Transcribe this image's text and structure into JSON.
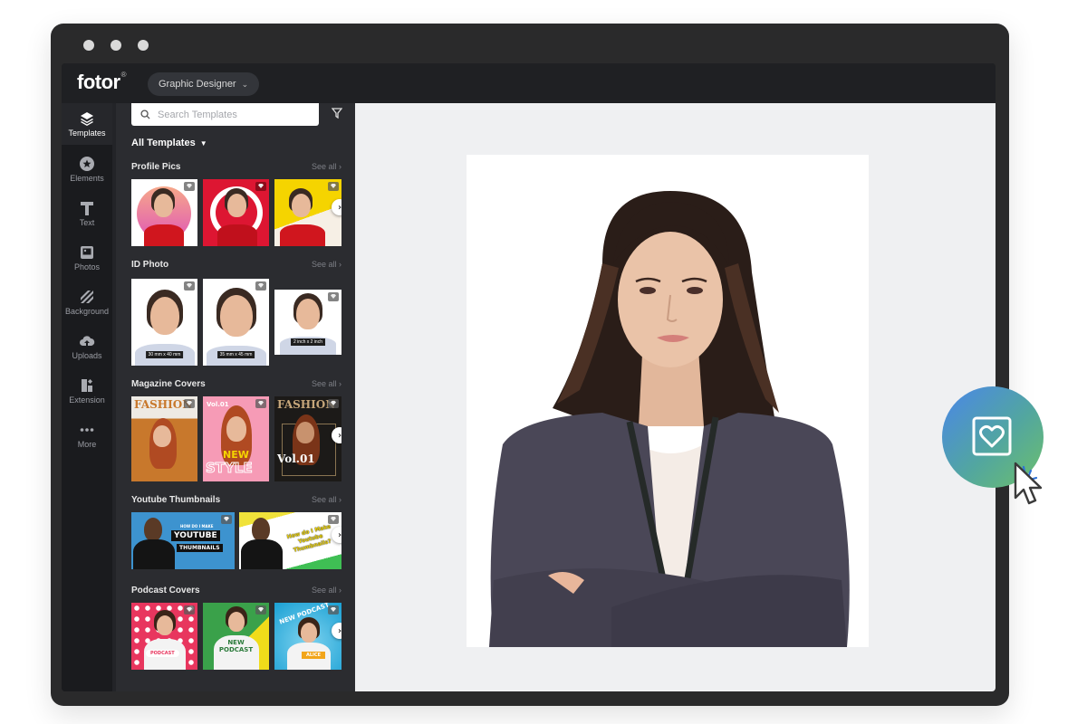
{
  "window": {
    "traffic_lights": [
      "dot",
      "dot",
      "dot"
    ]
  },
  "topbar": {
    "logo": "fotor",
    "logo_mark": "®",
    "mode_label": "Graphic Designer",
    "mode_icon": "chevron-down-icon"
  },
  "rail": {
    "items": [
      {
        "label": "Templates",
        "icon": "layers-icon",
        "active": true
      },
      {
        "label": "Elements",
        "icon": "star-circle-icon",
        "active": false
      },
      {
        "label": "Text",
        "icon": "text-t-icon",
        "active": false
      },
      {
        "label": "Photos",
        "icon": "photo-icon",
        "active": false
      },
      {
        "label": "Background",
        "icon": "stripes-icon",
        "active": false
      },
      {
        "label": "Uploads",
        "icon": "cloud-upload-icon",
        "active": false
      },
      {
        "label": "Extension",
        "icon": "extension-icon",
        "active": false
      },
      {
        "label": "More",
        "icon": "more-dots-icon",
        "active": false
      }
    ]
  },
  "panel": {
    "search_placeholder": "Search Templates",
    "filter_label": "All Templates",
    "see_all": "See all",
    "sections": [
      {
        "title": "Profile Pics",
        "see_all": "See all"
      },
      {
        "title": "ID Photo",
        "see_all": "See all",
        "size_labels": [
          "30 mm x 40 mm",
          "35 mm x 45 mm",
          "2 inch x 2 inch"
        ]
      },
      {
        "title": "Magazine Covers",
        "see_all": "See all",
        "cover_texts": [
          "FASHION",
          "Vol.01",
          "NEW",
          "STYLE",
          "FASHION",
          "Vol.01",
          "Vol.01"
        ]
      },
      {
        "title": "Youtube Thumbnails",
        "see_all": "See all",
        "thumb_texts": [
          "HOW DO I MAKE",
          "YOUTUBE",
          "THUMBNAILS",
          "How do I Make Youtube Thumbnails?"
        ]
      },
      {
        "title": "Podcast Covers",
        "see_all": "See all",
        "cover_texts": [
          "PODCAST",
          "NEW",
          "PODCAST",
          "NEW PODCAST",
          "ALICE"
        ]
      }
    ]
  },
  "colors": {
    "frame": "#2a2a2b",
    "app_bg": "#1f2023",
    "panel_bg": "#2b2c30",
    "canvas_bg": "#eff0f2",
    "accent_gradient_start": "#4a86ea",
    "accent_gradient_end": "#6dc06a"
  },
  "canvas": {
    "content": "ID photo of woman in dark blazer, arms crossed, white background"
  },
  "floating_action": {
    "icon": "favorite-frame-icon"
  }
}
